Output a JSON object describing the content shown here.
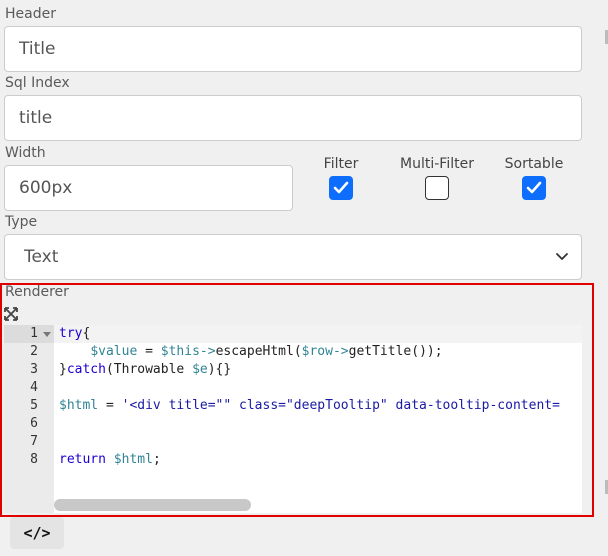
{
  "header": {
    "label": "Header",
    "value": "Title"
  },
  "sql_index": {
    "label": "Sql Index",
    "value": "title"
  },
  "width": {
    "label": "Width",
    "value": "600px"
  },
  "filter": {
    "label": "Filter",
    "checked": true
  },
  "multi_filter": {
    "label": "Multi-Filter",
    "checked": false
  },
  "sortable": {
    "label": "Sortable",
    "checked": true
  },
  "type": {
    "label": "Type",
    "value": "Text"
  },
  "renderer": {
    "label": "Renderer",
    "expand_icon": "expand-arrows-icon",
    "line_numbers": [
      "1",
      "2",
      "3",
      "4",
      "5",
      "6",
      "7",
      "8"
    ],
    "lines": [
      "try{",
      "    $value = $this->escapeHtml($row->getTitle());",
      "}catch(Throwable $e){}",
      "",
      "$html = '<div title=\"\" class=\"deepTooltip\" data-tooltip-content=",
      "",
      "",
      "return $html;"
    ]
  },
  "code_button": {
    "label": "</>",
    "icon": "code-icon"
  },
  "colors": {
    "accent": "#0d6efd",
    "highlight_border": "#e00000"
  }
}
